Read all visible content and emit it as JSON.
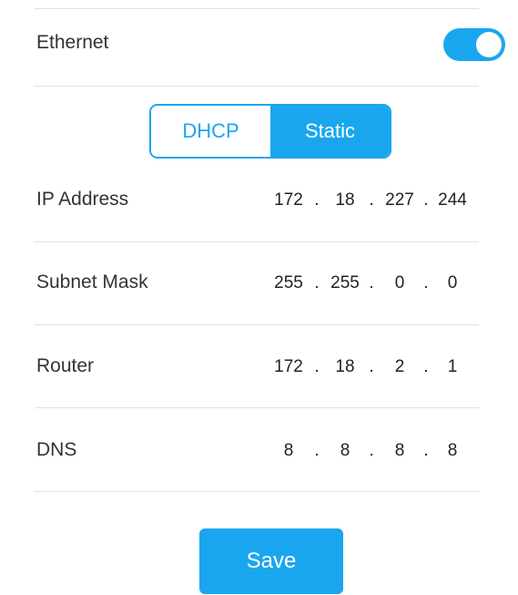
{
  "ethernet": {
    "label": "Ethernet",
    "enabled": true
  },
  "mode": {
    "options": [
      "DHCP",
      "Static"
    ],
    "selected": "Static"
  },
  "fields": [
    {
      "label": "IP Address",
      "octets": [
        "172",
        "18",
        "227",
        "244"
      ]
    },
    {
      "label": "Subnet Mask",
      "octets": [
        "255",
        "255",
        "0",
        "0"
      ]
    },
    {
      "label": "Router",
      "octets": [
        "172",
        "18",
        "2",
        "1"
      ]
    },
    {
      "label": "DNS",
      "octets": [
        "8",
        "8",
        "8",
        "8"
      ]
    }
  ],
  "separator": ".",
  "save_label": "Save",
  "colors": {
    "accent": "#1aa6ee",
    "text": "#333333",
    "divider": "#e1e1e1"
  }
}
